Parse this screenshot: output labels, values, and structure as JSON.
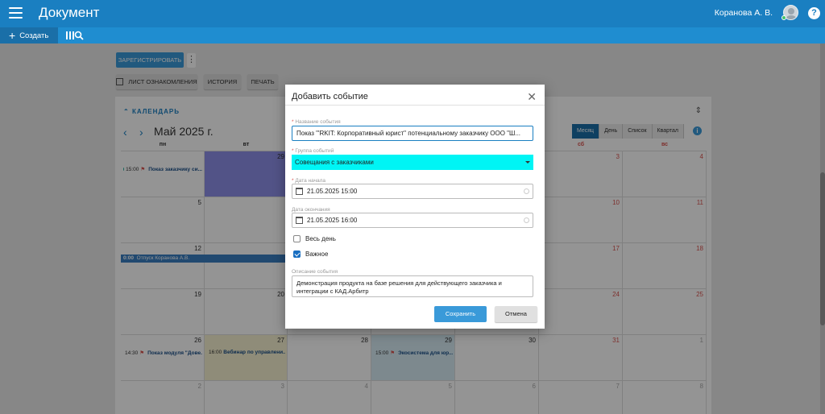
{
  "header": {
    "app_title": "Документ",
    "user_name": "Коранова А. В.",
    "help_label": "?"
  },
  "toolbar": {
    "create_label": "Создать"
  },
  "actions": {
    "register_label": "ЗАРЕГИСТРИРОВАТЬ",
    "more_label": "⋮",
    "acknowledgement_label": "ЛИСТ ОЗНАКОМЛЕНИЯ",
    "history_label": "ИСТОРИЯ",
    "print_label": "ПЕЧАТЬ"
  },
  "calendar": {
    "section_title": "КАЛЕНДАРЬ",
    "month_title": "Май 2025 г.",
    "views": [
      "Месяц",
      "День",
      "Список",
      "Квартал"
    ],
    "active_view": "Месяц",
    "weekdays_visible": [
      "пн",
      "вт",
      "сб",
      "вс"
    ],
    "weeks": [
      [
        "",
        "29",
        "",
        "",
        "",
        "3",
        "4"
      ],
      [
        "5",
        "",
        "",
        "",
        "",
        "10",
        "11"
      ],
      [
        "12",
        "",
        "",
        "",
        "",
        "17",
        "18"
      ],
      [
        "19",
        "20",
        "",
        "",
        "",
        "24",
        "25"
      ],
      [
        "26",
        "27",
        "28",
        "29",
        "30",
        "31",
        "1"
      ],
      [
        "2",
        "3",
        "4",
        "5",
        "6",
        "7",
        "8"
      ]
    ],
    "events": {
      "w1_mon": {
        "time": "15:00",
        "title": "Показ заказчику си..."
      },
      "vacation": {
        "time": "0:00",
        "title": "Отпуск Коранова А.В."
      },
      "w5_mon": {
        "time": "14:30",
        "title": "Показ модуля \"Дове..."
      },
      "w5_tue": {
        "time": "16:00",
        "title": "Вебинар по управлени..."
      },
      "w5_thu": {
        "time": "15:00",
        "title": "Экосистема для юр..."
      }
    }
  },
  "modal": {
    "title": "Добавить событие",
    "name_label": "Название события",
    "name_value": "Показ \"'RKIT: Корпоративный юрист\" потенциальному заказчику ООО \"Ш...",
    "group_label": "Группа событий",
    "group_value": "Совещания с заказчиками",
    "start_label": "Дата начала",
    "start_value": "21.05.2025 15:00",
    "end_label": "Дата окончания",
    "end_value": "21.05.2025 16:00",
    "all_day_label": "Весь день",
    "all_day_checked": false,
    "important_label": "Важное",
    "important_checked": true,
    "desc_label": "Описание события",
    "desc_value": "Демонстрация продукта на базе решения для действующего заказчика и интеграции с КАД.Арбитр",
    "save_label": "Сохранить",
    "cancel_label": "Отмена"
  },
  "colors": {
    "header_bg": "#1a7fc1",
    "accent": "#3a9ad9",
    "group_highlight": "#00f5f5",
    "weekend_red": "#d9534f"
  }
}
